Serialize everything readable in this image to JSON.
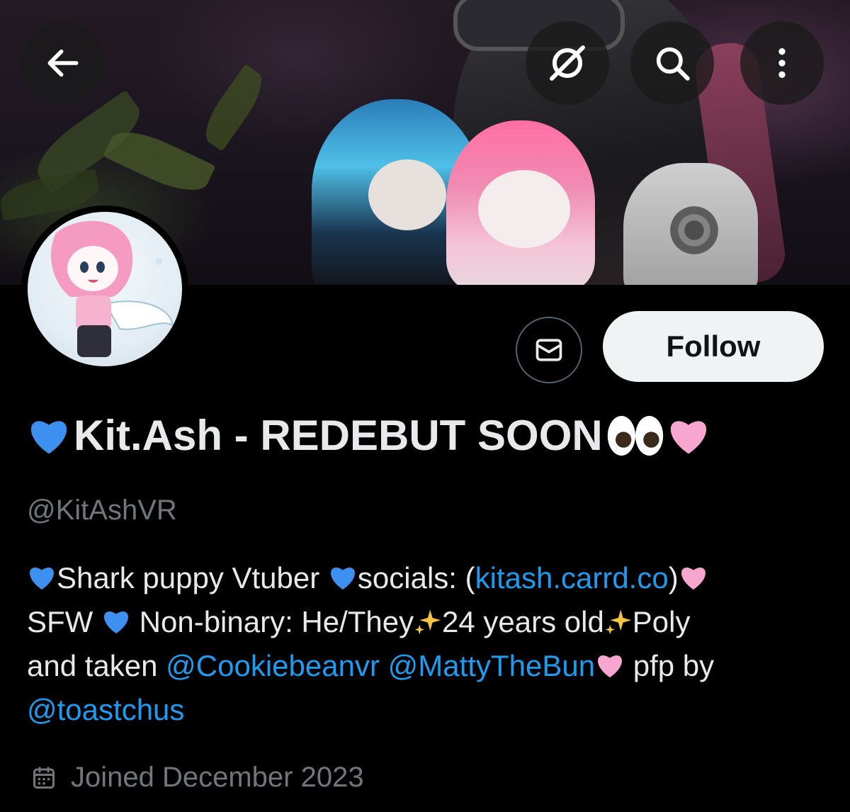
{
  "nav": {
    "back_icon": "arrow-left-icon",
    "grok_icon": "grok-slash-circle-icon",
    "search_icon": "search-icon",
    "more_icon": "more-vertical-icon"
  },
  "profile": {
    "display_name": "Kit.Ash - REDEBUT SOON",
    "handle": "@KitAshVR",
    "follow_label": "Follow",
    "message_icon": "envelope-icon"
  },
  "bio": {
    "l1_a": "Shark puppy Vtuber ",
    "l1_b": "socials: (",
    "l1_link": "kitash.carrd.co",
    "l1_c": ")",
    "l2_a": "SFW ",
    "l2_b": " Non-binary: He/They",
    "l2_c": "24 years old",
    "l2_d": "Poly",
    "l3_a": "and taken ",
    "l3_link1": "@Cookiebeanvr",
    "l3_link2": "@MattyTheBun",
    "l3_b": " pfp by",
    "l4_link": "@toastchus"
  },
  "joined": {
    "text": "Joined December 2023",
    "icon": "calendar-icon"
  },
  "colors": {
    "background": "#000000",
    "text": "#e7e9ea",
    "muted": "#71767b",
    "link": "#1d9bf0",
    "follow_bg": "#eff3f4",
    "blue_heart": "#3d8ff0",
    "pink_heart": "#f7a6cf"
  }
}
